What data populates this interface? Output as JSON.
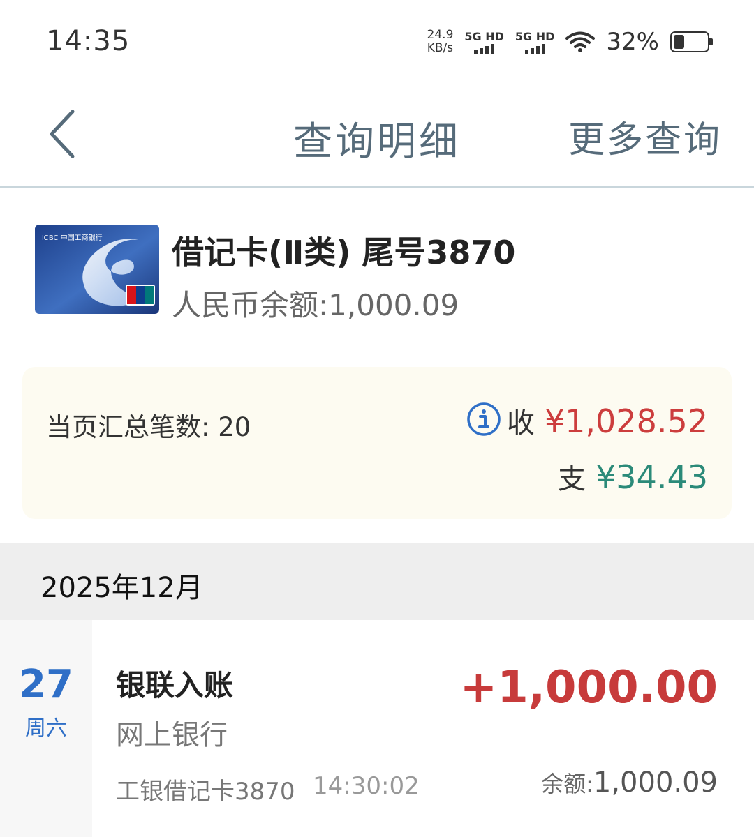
{
  "status_bar": {
    "time": "14:35",
    "net_speed_value": "24.9",
    "net_speed_unit": "KB/s",
    "sim1_label": "5G HD",
    "sim2_label": "5G HD",
    "battery_percent": "32%",
    "battery_level": 0.32
  },
  "header": {
    "title": "查询明细",
    "more_label": "更多查询",
    "back_icon": "chevron-left-icon"
  },
  "account": {
    "card_name": "借记卡(Ⅱ类) 尾号3870",
    "balance_text": "人民币余额:1,000.09",
    "card_image_text": "ICBC 中国工商银行"
  },
  "summary": {
    "count_text": "当页汇总笔数: 20",
    "income_label": "收",
    "income_amount": "¥1,028.52",
    "expense_label": "支",
    "expense_amount": "¥34.43",
    "colors": {
      "income": "#cc3d3d",
      "expense": "#2b8a79"
    }
  },
  "month": "2025年12月",
  "transactions": [
    {
      "day": "27",
      "weekday": "周六",
      "title": "银联入账",
      "channel": "网上银行",
      "card": "工银借记卡3870",
      "time": "14:30:02",
      "amount": "+1,000.00",
      "balance_label": "余额:",
      "balance_value": "1,000.09"
    }
  ]
}
